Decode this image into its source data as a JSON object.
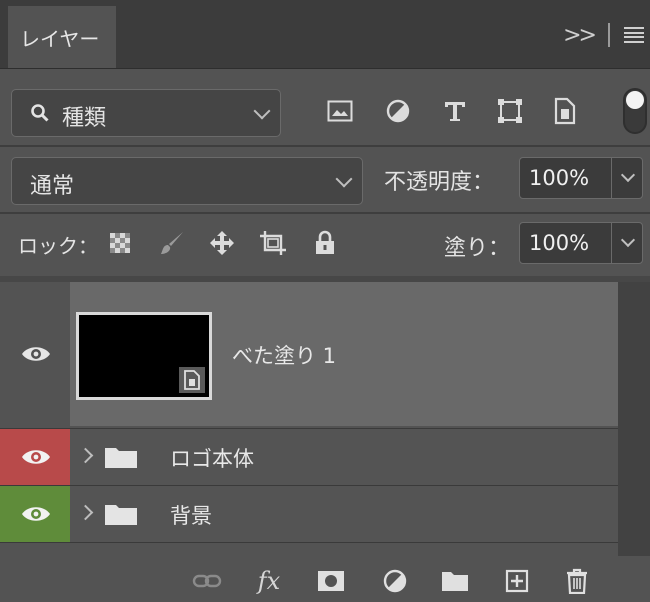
{
  "panel": {
    "tab_label": "レイヤー"
  },
  "filter": {
    "kind_value": "種類"
  },
  "blend": {
    "mode_value": "通常",
    "opacity_label": "不透明度：",
    "opacity_value": "100%"
  },
  "lock": {
    "label": "ロック：",
    "fill_label": "塗り：",
    "fill_value": "100%"
  },
  "layers": [
    {
      "name": "べた塗り 1",
      "type": "fill",
      "visible": true,
      "selected": true
    },
    {
      "name": "ロゴ本体",
      "type": "group",
      "visible": true,
      "color_label": "#b84a4a"
    },
    {
      "name": "背景",
      "type": "group",
      "visible": true,
      "color_label": "#5f8c3a"
    }
  ],
  "icons": {
    "tabbar": [
      "collapse-icon",
      "panel-menu-icon"
    ],
    "filters": [
      "image-filter-icon",
      "adjustment-filter-icon",
      "type-filter-icon",
      "shape-filter-icon",
      "smart-object-filter-icon"
    ],
    "locks": [
      "lock-transparent-pixels-icon",
      "lock-image-pixels-icon",
      "lock-position-icon",
      "lock-artboard-icon",
      "lock-all-icon"
    ],
    "bottom": [
      "link-layers-icon",
      "layer-style-icon",
      "add-mask-icon",
      "new-adjustment-layer-icon",
      "new-group-icon",
      "new-layer-icon",
      "delete-layer-icon"
    ]
  },
  "colors": {
    "panel_bg": "#535353",
    "selected_row": "#696969",
    "label_red": "#b84a4a",
    "label_green": "#5f8c3a"
  }
}
